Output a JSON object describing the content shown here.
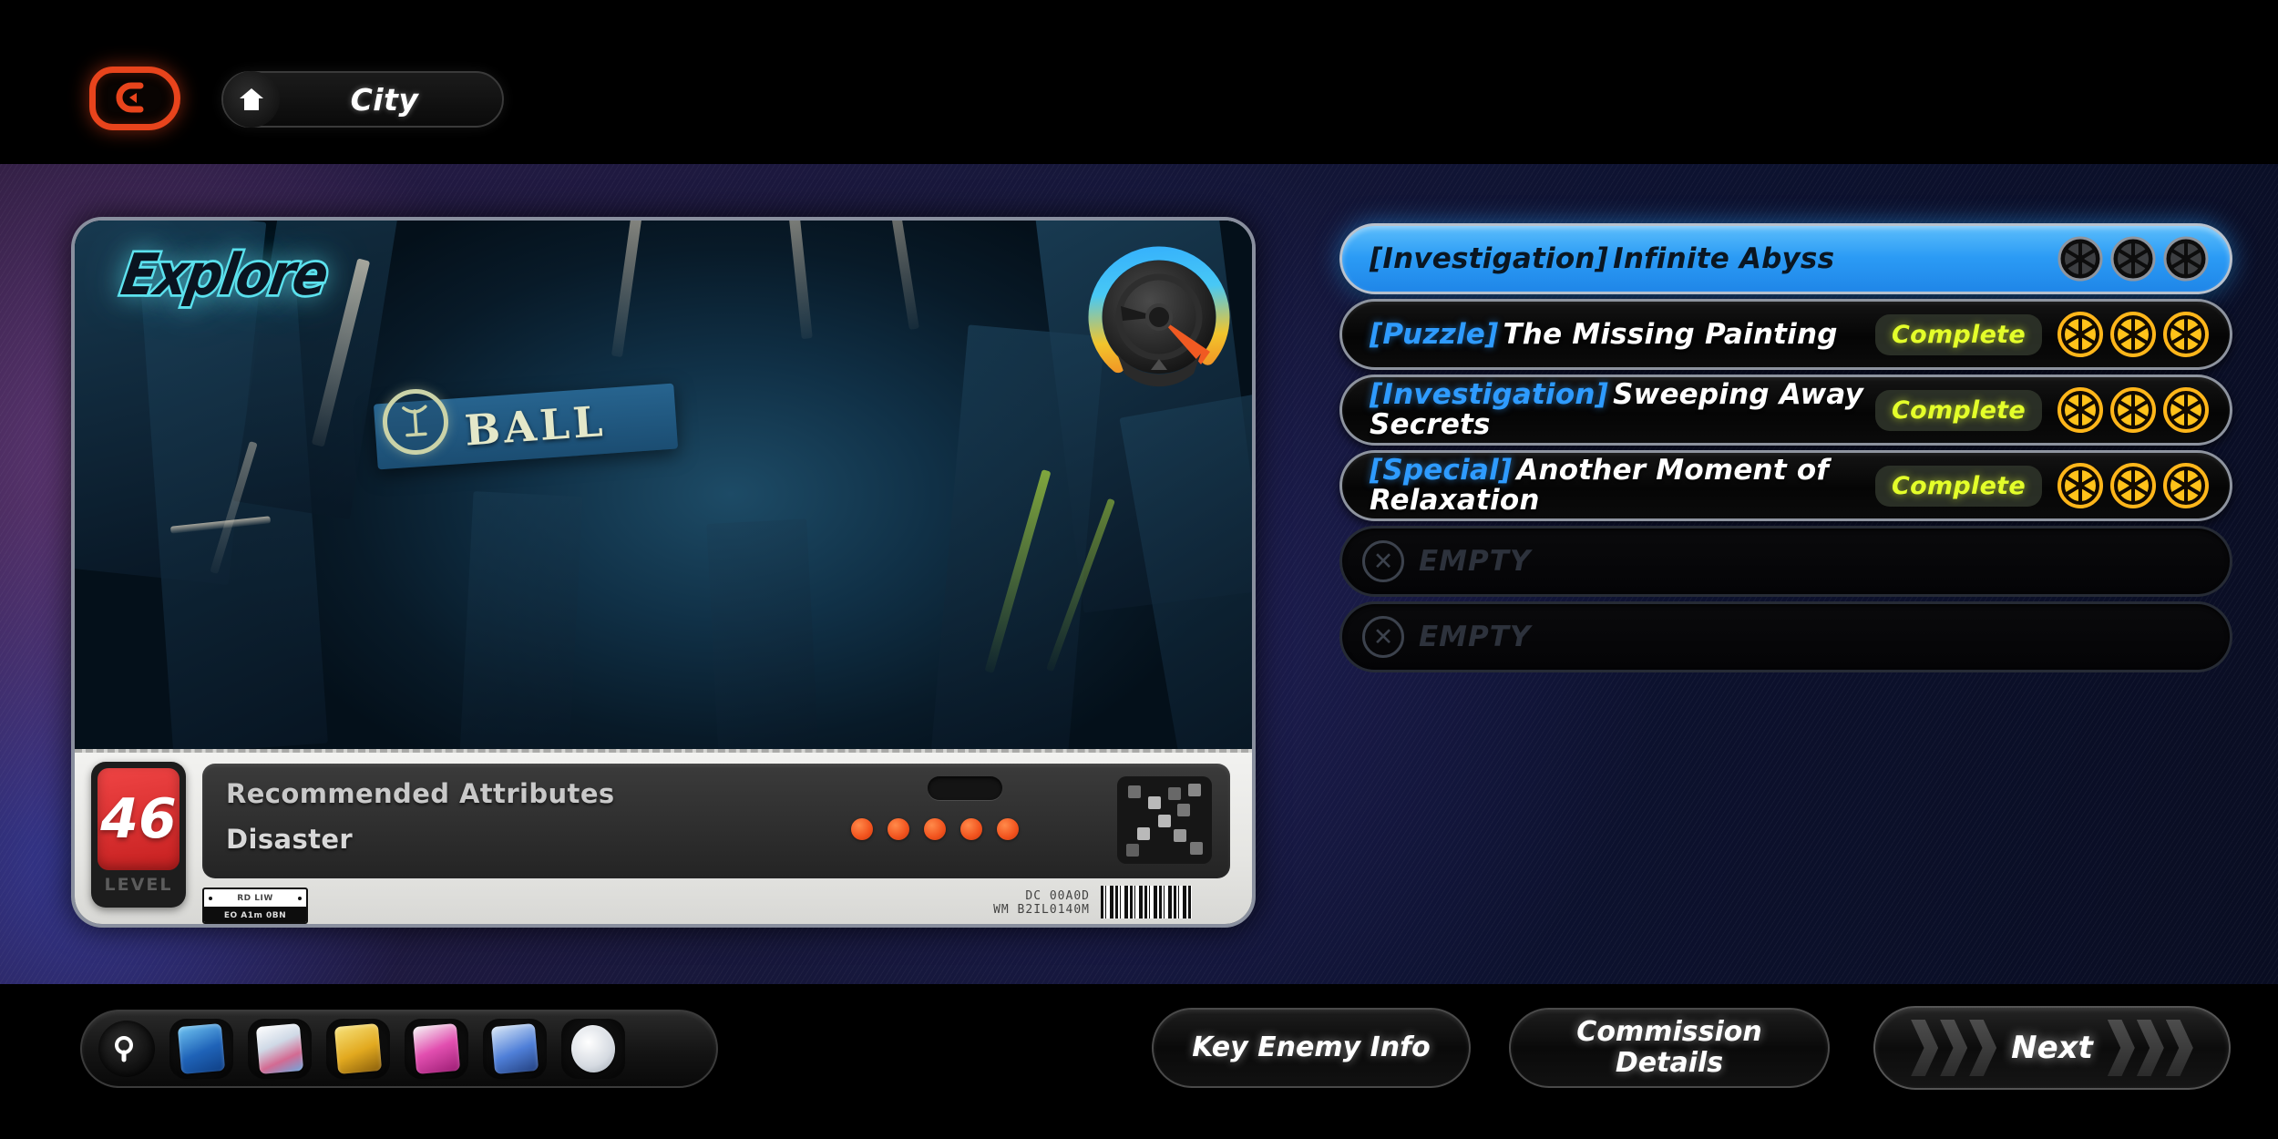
{
  "header": {
    "back_icon": "back-arrow-icon",
    "home_icon": "home-icon",
    "breadcrumb_label": "City"
  },
  "preview": {
    "title": "Explore",
    "scene_sign_text": "BALL",
    "gauge_icon": "compass-gauge-dial",
    "level": {
      "value": "46",
      "label": "LEVEL"
    },
    "attributes": {
      "heading": "Recommended Attributes",
      "value": "Disaster"
    },
    "difficulty_dots": 5,
    "qr_icon": "qr-pattern-icon",
    "strip_top": "RD LIW",
    "strip_bottom": "EO A1m 0BN",
    "serial_line1": "DC 00A0D",
    "serial_line2": "WM B2IL0140M"
  },
  "missions": [
    {
      "tag": "[Investigation]",
      "title": "Infinite Abyss",
      "status": "",
      "medals": 3,
      "medal_state": "locked",
      "selected": true,
      "empty": false
    },
    {
      "tag": "[Puzzle]",
      "title": "The Missing Painting",
      "status": "Complete",
      "medals": 3,
      "medal_state": "earned",
      "selected": false,
      "empty": false
    },
    {
      "tag": "[Investigation]",
      "title": "Sweeping Away Secrets",
      "status": "Complete",
      "medals": 3,
      "medal_state": "earned",
      "selected": false,
      "empty": false
    },
    {
      "tag": "[Special]",
      "title": "Another Moment of Relaxation",
      "status": "Complete",
      "medals": 3,
      "medal_state": "earned",
      "selected": false,
      "empty": false
    },
    {
      "tag": "",
      "title": "EMPTY",
      "status": "",
      "medals": 0,
      "medal_state": "none",
      "selected": false,
      "empty": true
    },
    {
      "tag": "",
      "title": "EMPTY",
      "status": "",
      "medals": 0,
      "medal_state": "none",
      "selected": false,
      "empty": true
    }
  ],
  "tray": {
    "search_icon": "search-icon",
    "items": [
      {
        "icon": "blue-card-icon",
        "color": "#2f7fd6"
      },
      {
        "icon": "white-card-icon",
        "color": "#dfe6ee"
      },
      {
        "icon": "gold-dice-icon",
        "color": "#e3b133"
      },
      {
        "icon": "magenta-box-icon",
        "color": "#d6399c"
      },
      {
        "icon": "blue-figure-icon",
        "color": "#4f7fd8"
      },
      {
        "icon": "white-orb-icon",
        "color": "#eef0f3"
      }
    ]
  },
  "actions": {
    "key_enemy_info": "Key Enemy Info",
    "commission_details_line1": "Commission",
    "commission_details_line2": "Details",
    "next": "Next"
  },
  "colors": {
    "accent_blue": "#2b9bf5",
    "tag_blue": "#2e9bff",
    "complete_yellow": "#e4ff2a",
    "medal_gold": "#ffc21a",
    "level_red": "#ef4444",
    "back_orange": "#e8441c",
    "explore_cyan": "#5fe3ef"
  }
}
